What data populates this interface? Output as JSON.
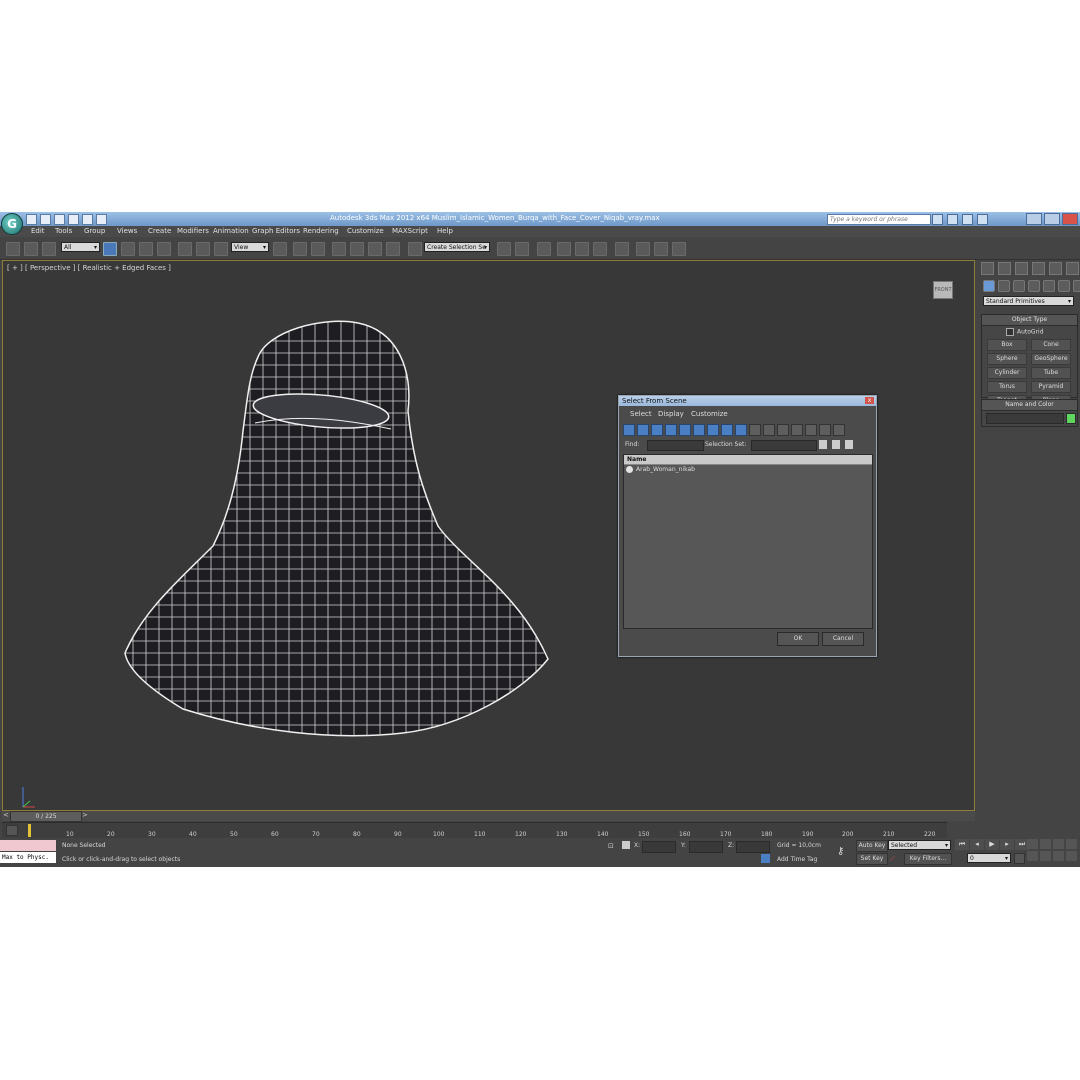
{
  "window": {
    "title": "Autodesk 3ds Max  2012 x64      Muslim_Islamic_Women_Burqa_with_Face_Cover_Niqab_vray.max",
    "search_placeholder": "Type a keyword or phrase"
  },
  "menu": [
    "Edit",
    "Tools",
    "Group",
    "Views",
    "Create",
    "Modifiers",
    "Animation",
    "Graph Editors",
    "Rendering",
    "Customize",
    "MAXScript",
    "Help"
  ],
  "toolbar": {
    "selection_filter": "All",
    "reference_coord": "View",
    "named_selection": "Create Selection Se"
  },
  "viewport": {
    "label": "[ + ] [ Perspective ] [ Realistic + Edged Faces ]",
    "viewcube_label": "FRONT"
  },
  "command_panel": {
    "category": "Standard Primitives",
    "object_type_title": "Object Type",
    "autogrid_label": "AutoGrid",
    "primitives": [
      "Box",
      "Cone",
      "Sphere",
      "GeoSphere",
      "Cylinder",
      "Tube",
      "Torus",
      "Pyramid",
      "Teapot",
      "Plane"
    ],
    "name_color_title": "Name and Color",
    "color": "#5fd45f"
  },
  "dialog": {
    "title": "Select From Scene",
    "close_glyph": "x",
    "menu": [
      "Select",
      "Display",
      "Customize"
    ],
    "find_label": "Find:",
    "selection_set_label": "Selection Set:",
    "column_header": "Name",
    "items": [
      "Arab_Woman_nikab"
    ],
    "ok_label": "OK",
    "cancel_label": "Cancel"
  },
  "timeline": {
    "frame_display": "0 / 225",
    "ticks": [
      "10",
      "20",
      "30",
      "40",
      "50",
      "60",
      "70",
      "80",
      "90",
      "100",
      "110",
      "120",
      "130",
      "140",
      "150",
      "160",
      "170",
      "180",
      "190",
      "200",
      "210",
      "220"
    ]
  },
  "status": {
    "maxscript_text": "Max to Physc.",
    "selection_info": "None Selected",
    "prompt": "Click or click-and-drag to select objects",
    "x_label": "X:",
    "y_label": "Y:",
    "z_label": "Z:",
    "grid": "Grid = 10,0cm",
    "add_time_tag": "Add Time Tag",
    "auto_key": "Auto Key",
    "set_key": "Set Key",
    "key_mode": "Selected",
    "key_filters": "Key Filters...",
    "current_frame": "0"
  }
}
